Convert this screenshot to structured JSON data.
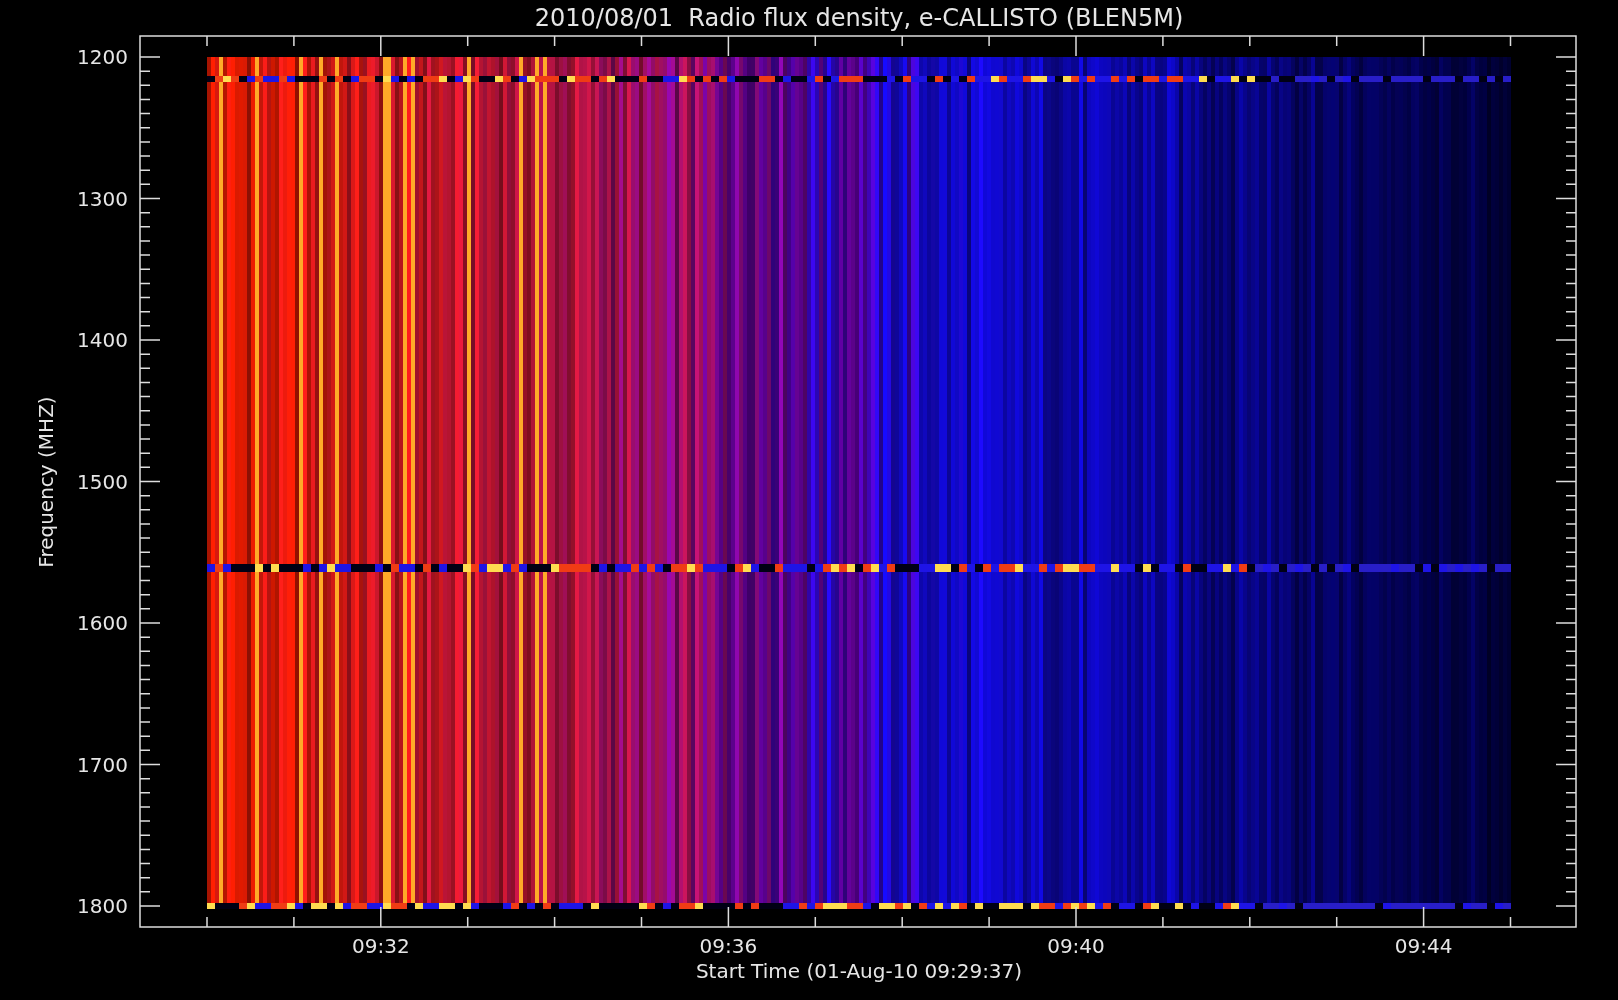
{
  "title": "2010/08/01  Radio flux density, e-CALLISTO (BLEN5M)",
  "y_axis": {
    "label": "Frequency (MHZ)",
    "ticks": [
      "1200",
      "1300",
      "1400",
      "1500",
      "1600",
      "1700",
      "1800"
    ]
  },
  "x_axis": {
    "label": "Start Time (01-Aug-10 09:29:37)",
    "ticks": [
      "09:32",
      "09:36",
      "09:40",
      "09:44"
    ]
  }
}
